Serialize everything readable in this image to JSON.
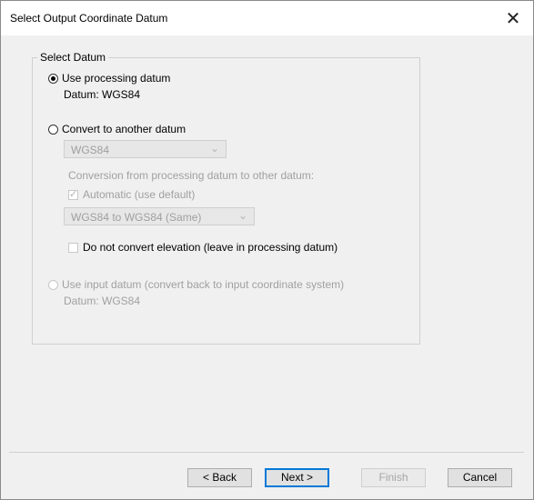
{
  "window": {
    "title": "Select Output Coordinate Datum",
    "close_glyph": "✕"
  },
  "group": {
    "legend": "Select Datum"
  },
  "options": {
    "processing": {
      "label": "Use processing datum",
      "sublabel": "Datum: WGS84",
      "checked": true
    },
    "convert": {
      "label": "Convert to another datum",
      "datum_select": "WGS84",
      "conversion_note": "Conversion from processing datum to other datum:",
      "automatic": {
        "label": "Automatic (use default)",
        "checked": true
      },
      "conversion_select": "WGS84 to WGS84 (Same)",
      "no_elevation": {
        "label": "Do not convert elevation (leave in processing datum)",
        "checked": false
      }
    },
    "input": {
      "label": "Use input datum (convert back to input coordinate system)",
      "sublabel": "Datum: WGS84",
      "checked": false
    }
  },
  "buttons": {
    "back": "< Back",
    "next": "Next >",
    "finish": "Finish",
    "cancel": "Cancel"
  },
  "icons": {
    "chevron": "chevron-down-icon",
    "check": "checkmark-icon",
    "close": "close-icon"
  }
}
